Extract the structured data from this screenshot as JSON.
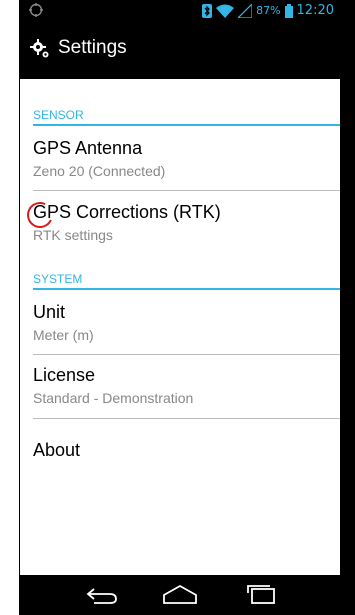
{
  "statusbar": {
    "battery": "87%",
    "time": "12:20"
  },
  "actionbar": {
    "title": "Settings"
  },
  "sections": [
    {
      "header": "SENSOR",
      "items": [
        {
          "title": "GPS Antenna",
          "subtitle": "Zeno 20 (Connected)"
        },
        {
          "title": "GPS Corrections (RTK)",
          "subtitle": "RTK settings"
        }
      ]
    },
    {
      "header": "SYSTEM",
      "items": [
        {
          "title": "Unit",
          "subtitle": "Meter (m)"
        },
        {
          "title": "License",
          "subtitle": "Standard - Demonstration"
        },
        {
          "title": "About",
          "subtitle": ""
        }
      ]
    }
  ],
  "colors": {
    "accent": "#33b5e5",
    "annotation": "#d81b1b"
  }
}
